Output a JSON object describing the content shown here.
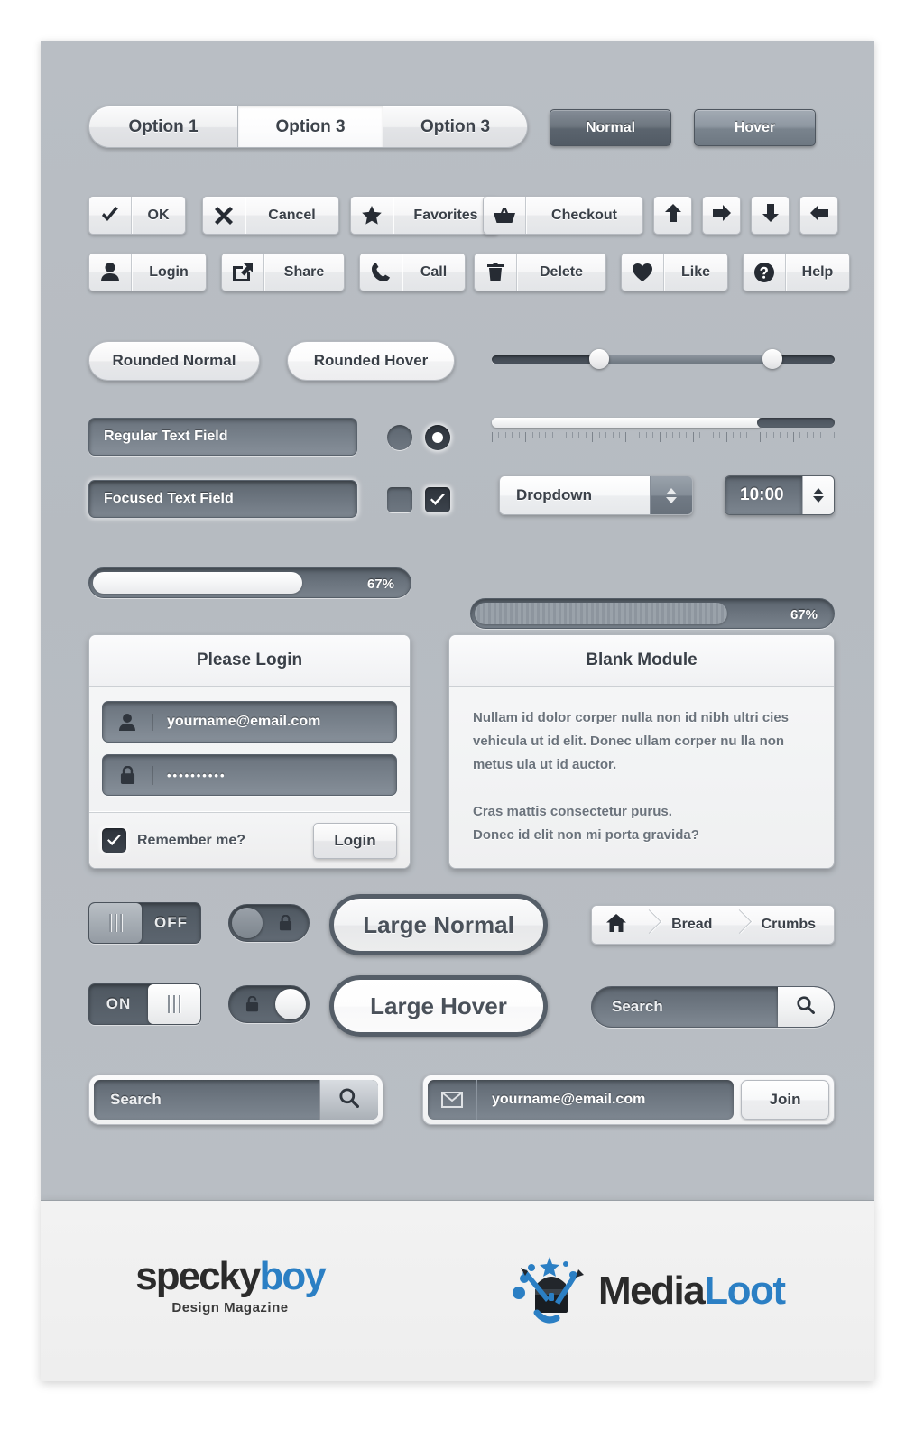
{
  "segmented": {
    "options": [
      {
        "label": "Option 1",
        "state": "normal"
      },
      {
        "label": "Option 3",
        "state": "active"
      },
      {
        "label": "Option 3",
        "state": "normal"
      }
    ]
  },
  "state_buttons": [
    {
      "label": "Normal",
      "state": "normal"
    },
    {
      "label": "Hover",
      "state": "hover"
    }
  ],
  "icon_buttons_row1": [
    {
      "label": "OK",
      "icon": "check-icon"
    },
    {
      "label": "Cancel",
      "icon": "close-icon"
    },
    {
      "label": "Favorites",
      "icon": "star-icon"
    },
    {
      "label": "Checkout",
      "icon": "basket-icon"
    }
  ],
  "arrow_buttons": [
    {
      "icon": "arrow-up-icon"
    },
    {
      "icon": "arrow-right-icon"
    },
    {
      "icon": "arrow-down-icon"
    },
    {
      "icon": "arrow-left-icon"
    }
  ],
  "icon_buttons_row2": [
    {
      "label": "Login",
      "icon": "user-icon"
    },
    {
      "label": "Share",
      "icon": "share-icon"
    },
    {
      "label": "Call",
      "icon": "phone-icon"
    },
    {
      "label": "Delete",
      "icon": "trash-icon"
    },
    {
      "label": "Like",
      "icon": "heart-icon"
    },
    {
      "label": "Help",
      "icon": "question-circle-icon"
    }
  ],
  "rounded_buttons": [
    {
      "label": "Rounded Normal",
      "state": "normal"
    },
    {
      "label": "Rounded Hover",
      "state": "hover"
    }
  ],
  "text_fields": [
    {
      "value": "Regular Text Field",
      "state": "regular"
    },
    {
      "value": "Focused Text Field",
      "state": "focused"
    }
  ],
  "radios": [
    {
      "name": "radio-unselected",
      "checked": false
    },
    {
      "name": "radio-selected",
      "checked": true
    }
  ],
  "checkboxes": [
    {
      "name": "checkbox-unchecked",
      "checked": false
    },
    {
      "name": "checkbox-checked",
      "checked": true
    }
  ],
  "range_slider": {
    "min": 0,
    "max": 100,
    "low": 31,
    "high": 82
  },
  "volume_slider": {
    "value": 79,
    "ticks": 52
  },
  "dropdown": {
    "value": "Dropdown"
  },
  "time_spinner": {
    "value": "10:00"
  },
  "progress": [
    {
      "percent": 67,
      "label": "67%",
      "style": "light"
    },
    {
      "percent": 67,
      "label": "67%",
      "style": "grey"
    }
  ],
  "login_module": {
    "title": "Please Login",
    "email_value": "yourname@email.com",
    "password_value": "••••••••••",
    "remember_label": "Remember me?",
    "remember_checked": true,
    "submit_label": "Login"
  },
  "blank_module": {
    "title": "Blank Module",
    "paragraphs": [
      "Nullam id dolor corper nulla non id nibh ultri cies vehicula ut id elit. Donec ullam corper nu lla non metus ula ut id auctor.",
      "Cras mattis consectetur purus.\nDonec id elit non mi porta gravida?"
    ]
  },
  "toggles": [
    {
      "label": "OFF",
      "state": "off"
    },
    {
      "label": "ON",
      "state": "on"
    }
  ],
  "lock_toggles": [
    {
      "state": "locked",
      "icon": "lock-closed-icon"
    },
    {
      "state": "unlocked",
      "icon": "lock-open-icon"
    }
  ],
  "large_buttons": [
    {
      "label": "Large Normal",
      "state": "normal"
    },
    {
      "label": "Large Hover",
      "state": "hover"
    }
  ],
  "breadcrumbs": {
    "home_icon": "home-icon",
    "items": [
      "Bread",
      "Crumbs"
    ]
  },
  "search_pill": {
    "placeholder": "Search",
    "icon": "search-icon"
  },
  "search_box": {
    "placeholder": "Search",
    "icon": "search-icon"
  },
  "newsletter": {
    "icon": "envelope-icon",
    "email_value": "yourname@email.com",
    "button_label": "Join"
  },
  "footer": {
    "speckyboy": {
      "part1": "specky",
      "part2": "boy",
      "tagline": "Design Magazine"
    },
    "medialoot": {
      "part1": "Media",
      "part2": "Loot",
      "icon": "treasure-chest-icon"
    }
  },
  "colors": {
    "canvas": "#b7bcc2",
    "accent_blue": "#2b7fc4",
    "dark": "#3a4048",
    "field_dark": "#6f7882"
  }
}
